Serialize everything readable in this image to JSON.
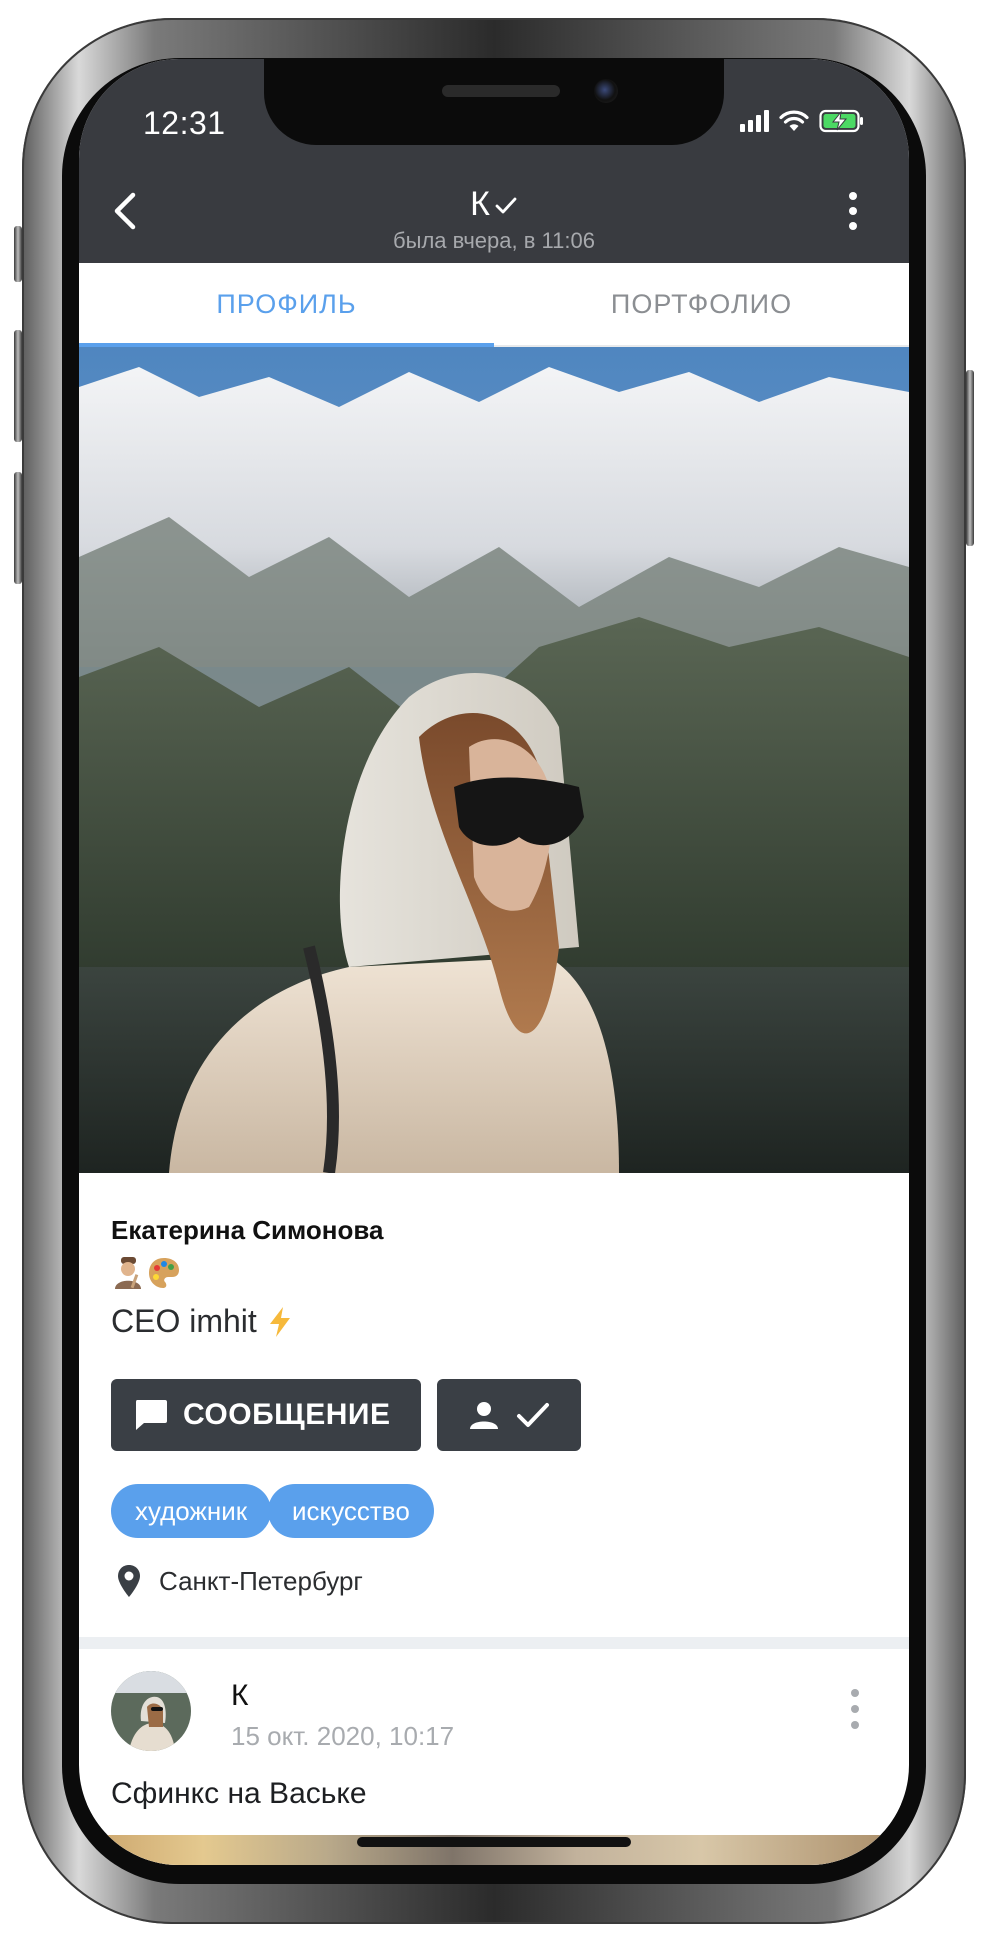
{
  "status_bar": {
    "time": "12:31"
  },
  "app_bar": {
    "title": "К",
    "subtitle": "была вчера, в 11:06"
  },
  "tabs": [
    {
      "label": "ПРОФИЛЬ",
      "active": true
    },
    {
      "label": "ПОРТФОЛИО",
      "active": false
    }
  ],
  "profile": {
    "name": "Екатерина Симонова",
    "bio": "CEO imhit",
    "emojis": [
      "artist-emoji",
      "palette-emoji"
    ],
    "message_button": "СООБЩЕНИЕ",
    "tags": [
      "художник",
      "искусство"
    ],
    "location": "Санкт-Петербург"
  },
  "post": {
    "author": "К",
    "time": "15 окт. 2020, 10:17",
    "text": "Сфинкс на Ваське"
  },
  "colors": {
    "app_bar": "#393b40",
    "accent": "#5aa0ec",
    "button": "#3a3f45",
    "tag": "#5aa0ec",
    "battery": "#4cd964"
  }
}
